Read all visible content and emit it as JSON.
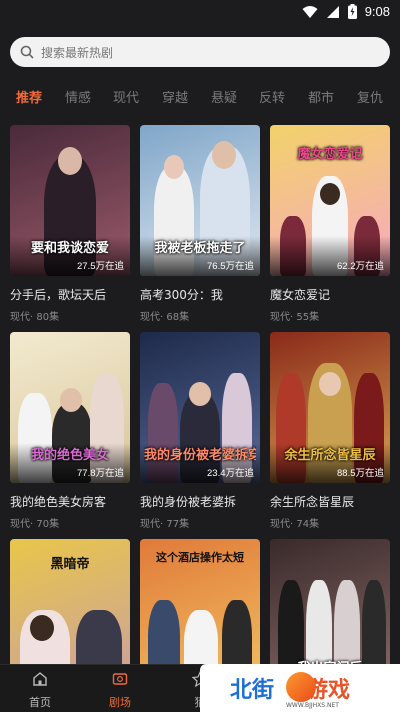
{
  "status_bar": {
    "time": "9:08"
  },
  "search": {
    "placeholder": "搜索最新热剧"
  },
  "tabs": [
    {
      "label": "推荐",
      "active": true
    },
    {
      "label": "情感",
      "active": false
    },
    {
      "label": "现代",
      "active": false
    },
    {
      "label": "穿越",
      "active": false
    },
    {
      "label": "悬疑",
      "active": false
    },
    {
      "label": "反转",
      "active": false
    },
    {
      "label": "都市",
      "active": false
    },
    {
      "label": "复仇",
      "active": false
    }
  ],
  "dramas": [
    {
      "title": "分手后，歌坛天后",
      "genre": "现代",
      "episodes": "80集",
      "poster_text": "要和我谈恋爱",
      "fans": "27.5万在追",
      "color1": "#4a2a3a",
      "color2": "#9a5a6a"
    },
    {
      "title": "高考300分：我",
      "genre": "现代",
      "episodes": "68集",
      "poster_text": "我被老板拖走了",
      "fans": "76.5万在追",
      "color1": "#7fa6c9",
      "color2": "#dfe7ef"
    },
    {
      "title": "魔女恋爱记",
      "genre": "现代",
      "episodes": "55集",
      "poster_text": "魔女恋爱记",
      "fans": "62.2万在追",
      "color1": "#f2d26a",
      "color2": "#f7a8c0"
    },
    {
      "title": "我的绝色美女房客",
      "genre": "现代",
      "episodes": "70集",
      "poster_text": "我的绝色美女",
      "fans": "77.8万在追",
      "color1": "#f2ead0",
      "color2": "#d9c69a"
    },
    {
      "title": "我的身份被老婆拆",
      "genre": "现代",
      "episodes": "77集",
      "poster_text": "我的身份被老婆拆穿了",
      "fans": "23.4万在追",
      "color1": "#1d2a4a",
      "color2": "#5a6a9a"
    },
    {
      "title": "余生所念皆星辰",
      "genre": "现代",
      "episodes": "74集",
      "poster_text": "余生所念皆星辰",
      "fans": "88.5万在追",
      "color1": "#8a2a1a",
      "color2": "#d9a050"
    },
    {
      "title": "",
      "genre": "",
      "episodes": "",
      "poster_text": "黑暗帝",
      "fans": "",
      "color1": "#e9c64a",
      "color2": "#c9a0a0"
    },
    {
      "title": "",
      "genre": "",
      "episodes": "",
      "poster_text": "这个酒店操作太短",
      "fans": "",
      "color1": "#e07a3a",
      "color2": "#f2c060"
    },
    {
      "title": "",
      "genre": "",
      "episodes": "",
      "poster_text": "我出家门后",
      "fans": "",
      "color1": "#3a2a2a",
      "color2": "#8a6a6a"
    }
  ],
  "bottom_nav": [
    {
      "label": "首页",
      "icon": "home-icon",
      "active": false
    },
    {
      "label": "剧场",
      "icon": "theater-icon",
      "active": true
    },
    {
      "label": "猜",
      "icon": "guess-icon",
      "active": false
    }
  ],
  "watermark": {
    "left_text": "北街",
    "right_text": "游戏",
    "url": "WWW.BJJHXS.NET"
  }
}
